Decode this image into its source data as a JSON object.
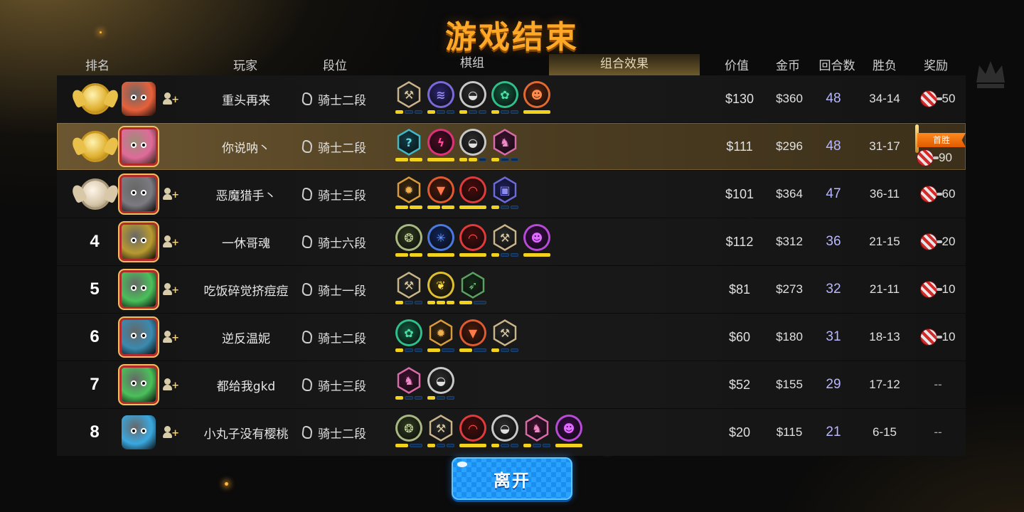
{
  "title": "游戏结束",
  "headers": {
    "rank": "排名",
    "player": "玩家",
    "tier": "段位",
    "deck": "棋组",
    "combo": "组合效果",
    "price": "价值",
    "gold": "金币",
    "rounds": "回合数",
    "winloss": "胜负",
    "reward": "奖励"
  },
  "first_win_label": "首胜",
  "leave_button": "离开",
  "colors": {
    "title": "#ffa726",
    "bar_on": "#f2d21c",
    "bar_off": "#0f2a4a",
    "rounds_text": "#b8b8ff",
    "button": "#1a8ff0",
    "highlight_row": "#6b5630"
  },
  "players": [
    {
      "rank": "1",
      "medal": "gold",
      "avatar": {
        "icon": "orange-dragon-avatar",
        "color": "#e8603a",
        "framed": false
      },
      "name": "重头再来",
      "tier": "骑士二段",
      "add_friend": true,
      "highlight": false,
      "synergies": [
        {
          "icon": "axe-icon",
          "shape": "hex",
          "ring": "#c9b48a",
          "color": "#2a2a2a",
          "fg": "#d8c8a0",
          "bars": [
            1,
            0,
            0
          ]
        },
        {
          "icon": "fish-bone-icon",
          "shape": "circle",
          "ring": "#7a6ad8",
          "color": "#2a2470",
          "fg": "#9a8af0",
          "bars": [
            1,
            0,
            0
          ]
        },
        {
          "icon": "helmet-icon",
          "shape": "circle",
          "ring": "#c8c8c8",
          "color": "#2c2c2c",
          "fg": "#e0e0e0",
          "bars": [
            1,
            0,
            0
          ]
        },
        {
          "icon": "paw-icon",
          "shape": "circle",
          "ring": "#2fbf8a",
          "color": "#105a3e",
          "fg": "#4fe0a8",
          "bars": [
            1,
            0,
            0
          ]
        },
        {
          "icon": "goblin-icon",
          "shape": "circle",
          "ring": "#e06a30",
          "color": "#5a2410",
          "fg": "#ff8a4a",
          "bars": [
            1
          ]
        }
      ],
      "price": "$130",
      "gold": "$360",
      "rounds": "48",
      "winloss": "34-14",
      "reward": "50",
      "first_win": false
    },
    {
      "rank": "2",
      "medal": "gold",
      "avatar": {
        "icon": "pink-dragon-avatar",
        "color": "#e06a9a",
        "framed": true
      },
      "name": "你说呐丶",
      "tier": "骑士二段",
      "add_friend": false,
      "highlight": true,
      "synergies": [
        {
          "icon": "mystery-icon",
          "shape": "hex",
          "ring": "#3fb8c8",
          "color": "#103e48",
          "fg": "#5fd8e8",
          "bars": [
            1,
            1
          ]
        },
        {
          "icon": "demon-icon",
          "shape": "circle",
          "ring": "#e0307a",
          "color": "#4a0a24",
          "fg": "#ff4a9a",
          "bars": [
            1
          ]
        },
        {
          "icon": "helmet-icon",
          "shape": "circle",
          "ring": "#c8c8c8",
          "color": "#2c2c2c",
          "fg": "#e0e0e0",
          "bars": [
            1,
            1,
            0
          ]
        },
        {
          "icon": "knight-icon",
          "shape": "hex",
          "ring": "#d86aa8",
          "color": "#3e1230",
          "fg": "#f08ac8",
          "bars": [
            1,
            0,
            0
          ]
        }
      ],
      "price": "$111",
      "gold": "$296",
      "rounds": "48",
      "winloss": "31-17",
      "reward": "90",
      "first_win": true
    },
    {
      "rank": "3",
      "medal": "bronze",
      "avatar": {
        "icon": "grey-dragon-avatar",
        "color": "#7a7a80",
        "framed": true
      },
      "name": "恶魔猎手丶",
      "tier": "骑士三段",
      "add_friend": true,
      "highlight": false,
      "synergies": [
        {
          "icon": "gear-icon",
          "shape": "hex",
          "ring": "#d89a3a",
          "color": "#3a2810",
          "fg": "#f0b050",
          "bars": [
            1,
            1
          ]
        },
        {
          "icon": "beast-icon",
          "shape": "circle",
          "ring": "#e05a30",
          "color": "#4a1a0a",
          "fg": "#ff7a4a",
          "bars": [
            1,
            1
          ]
        },
        {
          "icon": "arch-icon",
          "shape": "circle",
          "ring": "#e03a3a",
          "color": "#4a0a0a",
          "fg": "#ff5a5a",
          "bars": [
            1
          ]
        },
        {
          "icon": "mask-icon",
          "shape": "hex",
          "ring": "#6a6ad8",
          "color": "#1e1e5a",
          "fg": "#8a8af0",
          "bars": [
            1,
            0,
            0
          ]
        }
      ],
      "price": "$101",
      "gold": "$364",
      "rounds": "47",
      "winloss": "36-11",
      "reward": "60",
      "first_win": false
    },
    {
      "rank": "4",
      "medal": "",
      "avatar": {
        "icon": "wizard-avatar",
        "color": "#b89a30",
        "framed": true
      },
      "name": "一休哥魂",
      "tier": "骑士六段",
      "add_friend": true,
      "highlight": false,
      "synergies": [
        {
          "icon": "turtle-icon",
          "shape": "circle",
          "ring": "#a8b880",
          "color": "#2e3a1e",
          "fg": "#c8d8a0",
          "bars": [
            1,
            1
          ]
        },
        {
          "icon": "ice-icon",
          "shape": "circle",
          "ring": "#4a7ae0",
          "color": "#10245a",
          "fg": "#6a9aff",
          "bars": [
            1
          ]
        },
        {
          "icon": "arch-icon",
          "shape": "circle",
          "ring": "#e03a3a",
          "color": "#4a0a0a",
          "fg": "#ff5a5a",
          "bars": [
            1
          ]
        },
        {
          "icon": "axe-icon",
          "shape": "hex",
          "ring": "#c9b48a",
          "color": "#2a2a2a",
          "fg": "#d8c8a0",
          "bars": [
            1,
            0,
            0
          ]
        },
        {
          "icon": "devil-icon",
          "shape": "circle",
          "ring": "#b84ad8",
          "color": "#3a0a4a",
          "fg": "#e06aff",
          "bars": [
            1
          ]
        }
      ],
      "price": "$112",
      "gold": "$312",
      "rounds": "36",
      "winloss": "21-15",
      "reward": "20",
      "first_win": false
    },
    {
      "rank": "5",
      "medal": "",
      "avatar": {
        "icon": "green-orc-avatar",
        "color": "#4ac05a",
        "framed": true
      },
      "name": "吃饭碎觉挤痘痘",
      "tier": "骑士一段",
      "add_friend": true,
      "highlight": false,
      "synergies": [
        {
          "icon": "axe-icon",
          "shape": "hex",
          "ring": "#c9b48a",
          "color": "#2a2a2a",
          "fg": "#d8c8a0",
          "bars": [
            1,
            0,
            0
          ]
        },
        {
          "icon": "elf-icon",
          "shape": "circle",
          "ring": "#e0c030",
          "color": "#3a3010",
          "fg": "#ffe050",
          "bars": [
            1,
            1,
            1
          ]
        },
        {
          "icon": "hunter-icon",
          "shape": "hex",
          "ring": "#5aa060",
          "color": "#142a18",
          "fg": "#7ac080",
          "bars": [
            1,
            0
          ]
        }
      ],
      "price": "$81",
      "gold": "$273",
      "rounds": "32",
      "winloss": "21-11",
      "reward": "10",
      "first_win": false
    },
    {
      "rank": "6",
      "medal": "",
      "avatar": {
        "icon": "blue-creature-avatar",
        "color": "#3a8ab0",
        "framed": true
      },
      "name": "逆反温妮",
      "tier": "骑士二段",
      "add_friend": true,
      "highlight": false,
      "synergies": [
        {
          "icon": "paw-icon",
          "shape": "circle",
          "ring": "#2fbf8a",
          "color": "#105a3e",
          "fg": "#4fe0a8",
          "bars": [
            1,
            0,
            0
          ]
        },
        {
          "icon": "gear-icon",
          "shape": "hex",
          "ring": "#d89a3a",
          "color": "#3a2810",
          "fg": "#f0b050",
          "bars": [
            1,
            0
          ]
        },
        {
          "icon": "beast-icon",
          "shape": "circle",
          "ring": "#e05a30",
          "color": "#4a1a0a",
          "fg": "#ff7a4a",
          "bars": [
            1,
            0
          ]
        },
        {
          "icon": "axe-icon",
          "shape": "hex",
          "ring": "#c9b48a",
          "color": "#2a2a2a",
          "fg": "#d8c8a0",
          "bars": [
            1,
            0,
            0
          ]
        }
      ],
      "price": "$60",
      "gold": "$180",
      "rounds": "31",
      "winloss": "18-13",
      "reward": "10",
      "first_win": false
    },
    {
      "rank": "7",
      "medal": "",
      "avatar": {
        "icon": "green-orc-avatar",
        "color": "#4ac05a",
        "framed": true
      },
      "name": "都给我gkd",
      "tier": "骑士三段",
      "add_friend": true,
      "highlight": false,
      "synergies": [
        {
          "icon": "knight-icon",
          "shape": "hex",
          "ring": "#d86aa8",
          "color": "#3e1230",
          "fg": "#f08ac8",
          "bars": [
            1,
            0,
            0
          ]
        },
        {
          "icon": "helmet-icon",
          "shape": "circle",
          "ring": "#c8c8c8",
          "color": "#2c2c2c",
          "fg": "#e0e0e0",
          "bars": [
            1,
            0,
            0
          ]
        }
      ],
      "price": "$52",
      "gold": "$155",
      "rounds": "29",
      "winloss": "17-12",
      "reward": "--",
      "first_win": false
    },
    {
      "rank": "8",
      "medal": "",
      "avatar": {
        "icon": "blonde-hero-avatar",
        "color": "#3aa8e0",
        "framed": false
      },
      "name": "小丸子没有樱桃",
      "tier": "骑士二段",
      "add_friend": true,
      "highlight": false,
      "synergies": [
        {
          "icon": "turtle-icon",
          "shape": "circle",
          "ring": "#a8b880",
          "color": "#2e3a1e",
          "fg": "#c8d8a0",
          "bars": [
            1,
            0
          ]
        },
        {
          "icon": "axe-icon",
          "shape": "hex",
          "ring": "#c9b48a",
          "color": "#2a2a2a",
          "fg": "#d8c8a0",
          "bars": [
            1,
            0,
            0
          ]
        },
        {
          "icon": "arch-icon",
          "shape": "circle",
          "ring": "#e03a3a",
          "color": "#4a0a0a",
          "fg": "#ff5a5a",
          "bars": [
            1
          ]
        },
        {
          "icon": "helmet-icon",
          "shape": "circle",
          "ring": "#c8c8c8",
          "color": "#2c2c2c",
          "fg": "#e0e0e0",
          "bars": [
            1,
            0,
            0
          ]
        },
        {
          "icon": "knight-icon",
          "shape": "hex",
          "ring": "#d86aa8",
          "color": "#3e1230",
          "fg": "#f08ac8",
          "bars": [
            1,
            0,
            0
          ]
        },
        {
          "icon": "devil-icon",
          "shape": "circle",
          "ring": "#b84ad8",
          "color": "#3a0a4a",
          "fg": "#e06aff",
          "bars": [
            1
          ]
        }
      ],
      "price": "$20",
      "gold": "$115",
      "rounds": "21",
      "winloss": "6-15",
      "reward": "--",
      "first_win": false
    }
  ]
}
